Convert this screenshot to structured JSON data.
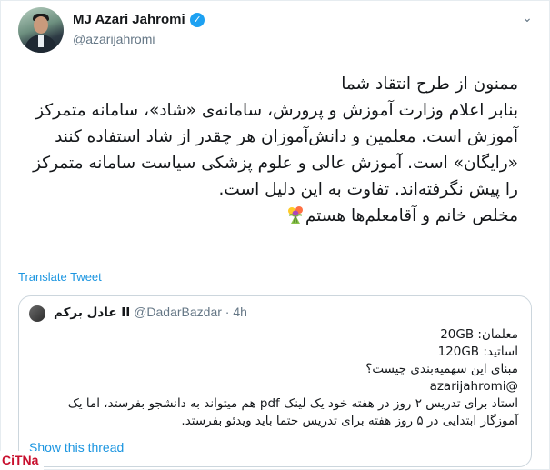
{
  "tweet": {
    "author_name": "MJ Azari Jahromi",
    "author_handle": "@azarijahromi",
    "verified_mark": "✓",
    "caret": "⌄",
    "lines": [
      "ممنون از طرح انتقاد شما",
      "بنابر اعلام وزارت آموزش و پرورش، سامانه‌ی «شاد»، سامانه متمرکز آموزش است. معلمین و دانش‌آموزان هر چقدر از شاد استفاده کنند «رایگان» است. آموزش عالی و علوم پزشکی سیاست سامانه متمرکز را پیش نگرفته‌اند. تفاوت به این دلیل است.",
      "مخلص خانم و آقامعلم‌ها هستم"
    ],
    "translate_label": "Translate Tweet"
  },
  "quoted_tweet": {
    "author_name": "عادل برکم II",
    "author_handle": "@DadarBazdar",
    "separator": "·",
    "time": "4h",
    "lines": [
      "معلمان: 20GB",
      "اساتید: 120GB",
      "مبنای این سهمیه‌بندی چیست؟",
      "@azarijahromi",
      "استاد برای تدریس ۲ روز در هفته خود یک لینک pdf هم میتواند به دانشجو بفرستد، اما یک آموزگار ابتدایی در ۵ روز هفته برای تدریس حتما باید ویدئو بفرستد."
    ],
    "show_thread_label": "Show this thread"
  },
  "watermark": "CiTNa",
  "colors": {
    "link": "#1b95e0",
    "verified": "#1da1f2",
    "secondary_text": "#657786",
    "border": "#ccd6dd",
    "watermark": "#c8102e"
  },
  "icons": {
    "verified": "verified-badge-icon",
    "caret": "chevron-down-icon",
    "emoji": "bouquet-emoji-icon"
  }
}
